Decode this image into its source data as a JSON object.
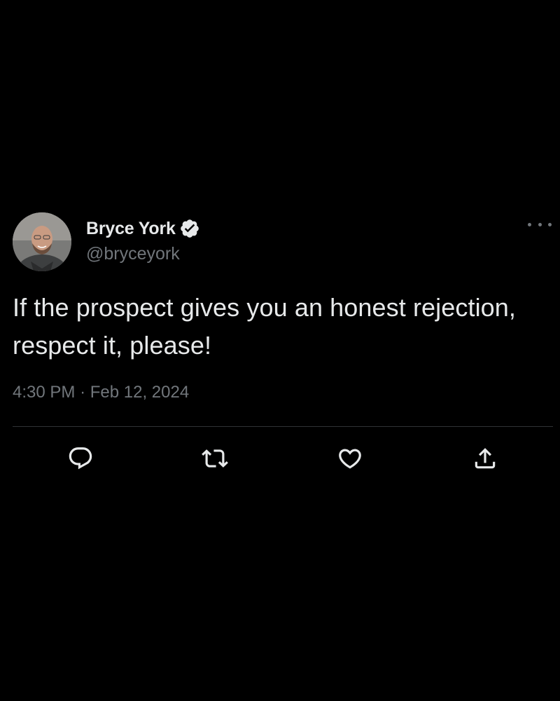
{
  "author": {
    "display_name": "Bryce York",
    "handle": "@bryceyork",
    "verified": true,
    "avatar_icon": "person-avatar"
  },
  "tweet": {
    "text": "If the prospect gives you an honest rejection, respect it, please!",
    "time": "4:30 PM",
    "separator": "·",
    "date": "Feb 12, 2024"
  },
  "actions": {
    "reply_icon": "reply-icon",
    "retweet_icon": "retweet-icon",
    "like_icon": "heart-icon",
    "share_icon": "share-icon",
    "more_icon": "more-options-icon"
  },
  "colors": {
    "background": "#000000",
    "primary_text": "#e7e9ea",
    "secondary_text": "#71767b",
    "divider": "#2f3336"
  }
}
